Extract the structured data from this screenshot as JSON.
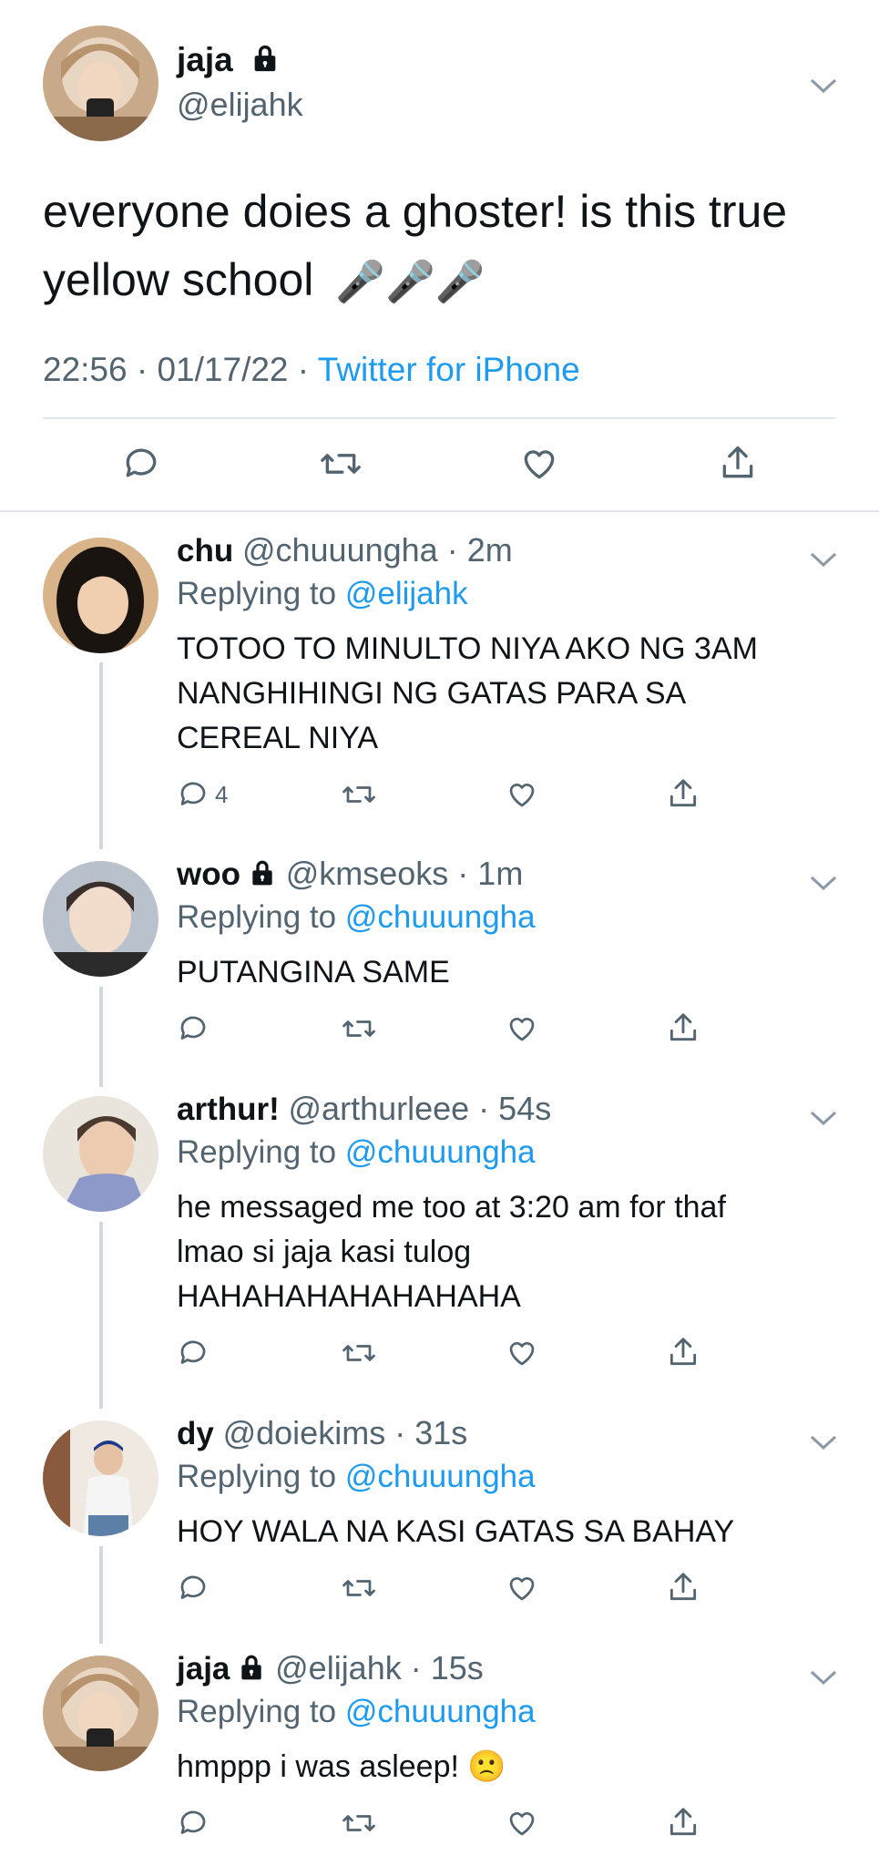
{
  "main_tweet": {
    "name": "jaja",
    "handle": "@elijahk",
    "text_line1": "everyone doies a ghoster! is this true",
    "text_line2": "yellow school",
    "emoji": "🎤🎤🎤",
    "time": "22:56",
    "date": "01/17/22",
    "source": "Twitter for iPhone",
    "actions": [
      "reply-icon",
      "retweet-icon",
      "like-icon",
      "share-icon"
    ]
  },
  "replies": [
    {
      "name": "chu",
      "handle": "@chuuungha",
      "time": "2m",
      "replying_label": "Replying to",
      "replying_to": "@elijahk",
      "lines": [
        "TOTOO TO MINULTO NIYA AKO NG 3AM",
        "NANGHIHINGI NG GATAS PARA SA",
        "CEREAL NIYA"
      ],
      "reply_count": "4",
      "locked": false
    },
    {
      "name": "woo",
      "handle": "@kmseoks",
      "time": "1m",
      "replying_label": "Replying to",
      "replying_to": "@chuuungha",
      "lines": [
        "PUTANGINA SAME"
      ],
      "reply_count": "",
      "locked": true
    },
    {
      "name": "arthur!",
      "handle": "@arthurleee",
      "time": "54s",
      "replying_label": "Replying to",
      "replying_to": "@chuuungha",
      "lines": [
        "he messaged me too at 3:20 am for thaf",
        "lmao si jaja kasi tulog",
        "HAHAHAHAHAHAHAHA"
      ],
      "reply_count": "",
      "locked": false
    },
    {
      "name": "dy",
      "handle": "@doiekims",
      "time": "31s",
      "replying_label": "Replying to",
      "replying_to": "@chuuungha",
      "lines": [
        "HOY WALA NA KASI GATAS SA BAHAY"
      ],
      "reply_count": "",
      "locked": false
    },
    {
      "name": "jaja",
      "handle": "@elijahk",
      "time": "15s",
      "replying_label": "Replying to",
      "replying_to": "@chuuungha",
      "lines": [
        "hmppp i was asleep! 🙁"
      ],
      "reply_count": "",
      "locked": true
    }
  ],
  "colors": {
    "link": "#1d9bf0",
    "muted": "#536471",
    "divider": "#e1e6ea",
    "thread": "#cfd9de"
  }
}
